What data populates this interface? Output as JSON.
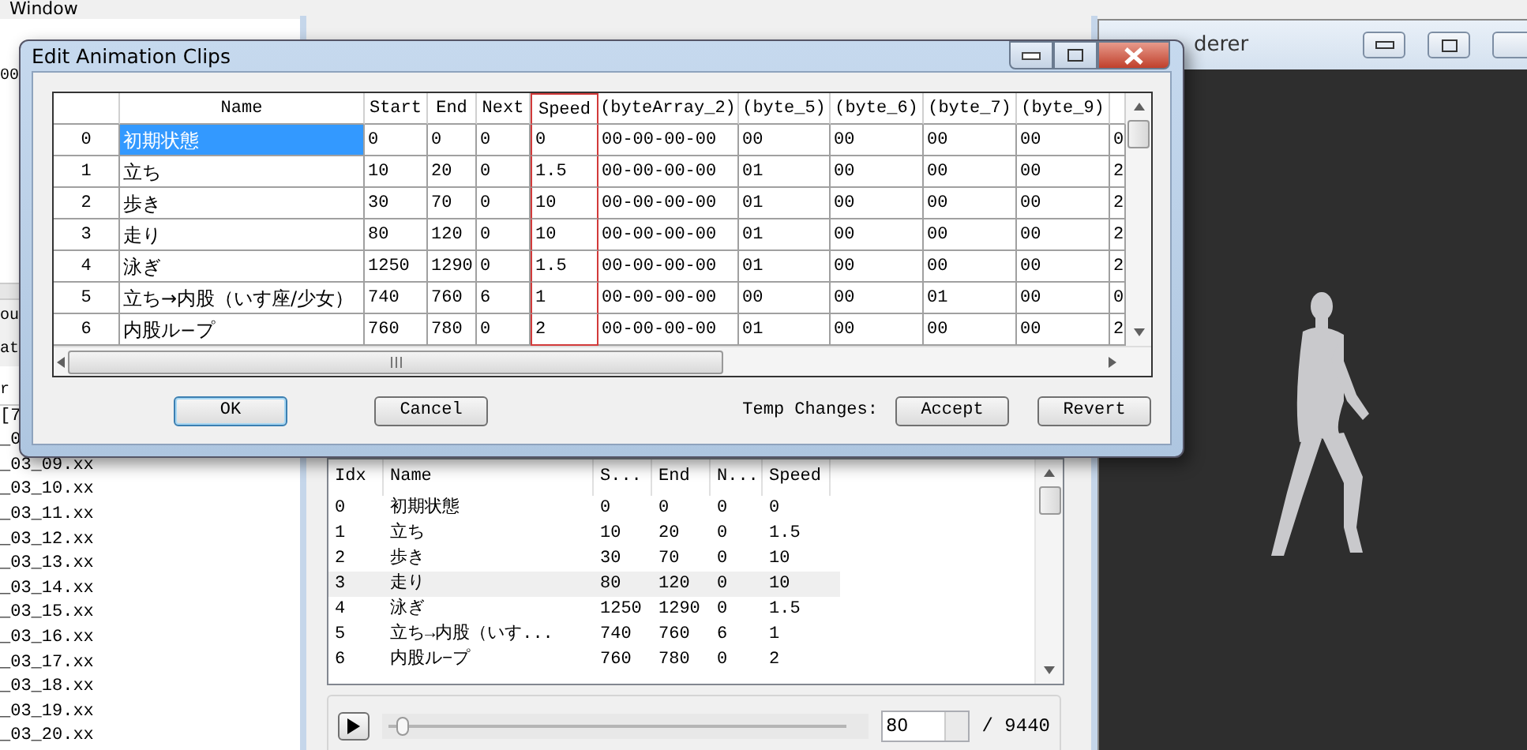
{
  "main_window": {
    "menu": [
      {
        "label": "Window"
      }
    ],
    "left_panel": {
      "path_fragment": "00",
      "labels": [
        "ou",
        "at"
      ],
      "list_header": "r",
      "list_items": [
        "[7",
        "_0",
        "_03_09.xx",
        "_03_10.xx",
        "_03_11.xx",
        "_03_12.xx",
        "_03_13.xx",
        "_03_14.xx",
        "_03_15.xx",
        "_03_16.xx",
        "_03_17.xx",
        "_03_18.xx",
        "_03_19.xx",
        "_03_20.xx"
      ]
    }
  },
  "clip_window": {
    "columns": [
      "Idx",
      "Name",
      "S...",
      "End",
      "N...",
      "Speed"
    ],
    "rows": [
      {
        "cells": [
          "0",
          "初期状態",
          "0",
          "0",
          "0",
          "0"
        ],
        "selected": false
      },
      {
        "cells": [
          "1",
          "立ち",
          "10",
          "20",
          "0",
          "1.5"
        ],
        "selected": false
      },
      {
        "cells": [
          "2",
          "歩き",
          "30",
          "70",
          "0",
          "10"
        ],
        "selected": false
      },
      {
        "cells": [
          "3",
          "走り",
          "80",
          "120",
          "0",
          "10"
        ],
        "selected": true
      },
      {
        "cells": [
          "4",
          "泳ぎ",
          "1250",
          "1290",
          "0",
          "1.5"
        ],
        "selected": false
      },
      {
        "cells": [
          "5",
          "立ち→内股（いす...",
          "740",
          "760",
          "6",
          "1"
        ],
        "selected": false
      },
      {
        "cells": [
          "6",
          "内股ル−プ",
          "760",
          "780",
          "0",
          "2"
        ],
        "selected": false
      }
    ],
    "playback": {
      "level": 0.03,
      "frame": "80",
      "total": "/ 9440"
    }
  },
  "renderer_window": {
    "title": "derer"
  },
  "dialog": {
    "title": "Edit Animation Clips",
    "columns": [
      {
        "label": "Name",
        "highlighted": false
      },
      {
        "label": "Start",
        "highlighted": false
      },
      {
        "label": "End",
        "highlighted": false
      },
      {
        "label": "Next",
        "highlighted": false
      },
      {
        "label": "Speed",
        "highlighted": true
      },
      {
        "label": "(byteArray_2)",
        "highlighted": false
      },
      {
        "label": "(byte_5)",
        "highlighted": false
      },
      {
        "label": "(byte_6)",
        "highlighted": false
      },
      {
        "label": "(byte_7)",
        "highlighted": false
      },
      {
        "label": "(byte_9)",
        "highlighted": false
      }
    ],
    "rows": [
      {
        "index": "0",
        "cells": [
          "初期状態",
          "0",
          "0",
          "0",
          "0",
          "00-00-00-00",
          "00",
          "00",
          "00",
          "00",
          "0"
        ],
        "selected": true
      },
      {
        "index": "1",
        "cells": [
          "立ち",
          "10",
          "20",
          "0",
          "1.5",
          "00-00-00-00",
          "01",
          "00",
          "00",
          "00",
          "2"
        ],
        "selected": false
      },
      {
        "index": "2",
        "cells": [
          "歩き",
          "30",
          "70",
          "0",
          "10",
          "00-00-00-00",
          "01",
          "00",
          "00",
          "00",
          "2"
        ],
        "selected": false
      },
      {
        "index": "3",
        "cells": [
          "走り",
          "80",
          "120",
          "0",
          "10",
          "00-00-00-00",
          "01",
          "00",
          "00",
          "00",
          "2"
        ],
        "selected": false
      },
      {
        "index": "4",
        "cells": [
          "泳ぎ",
          "1250",
          "1290",
          "0",
          "1.5",
          "00-00-00-00",
          "01",
          "00",
          "00",
          "00",
          "2"
        ],
        "selected": false
      },
      {
        "index": "5",
        "cells": [
          "立ち→内股（いす座/少女）",
          "740",
          "760",
          "6",
          "1",
          "00-00-00-00",
          "00",
          "00",
          "01",
          "00",
          "0"
        ],
        "selected": false
      },
      {
        "index": "6",
        "cells": [
          "内股ル−プ",
          "760",
          "780",
          "0",
          "2",
          "00-00-00-00",
          "01",
          "00",
          "00",
          "00",
          "2"
        ],
        "selected": false
      }
    ],
    "buttons": [
      {
        "label": "OK",
        "default": true
      },
      {
        "label": "Cancel",
        "default": false
      }
    ],
    "temp_label": "Temp Changes:",
    "temp_buttons": [
      {
        "label": "Accept",
        "default": false
      },
      {
        "label": "Revert",
        "default": false
      }
    ]
  }
}
